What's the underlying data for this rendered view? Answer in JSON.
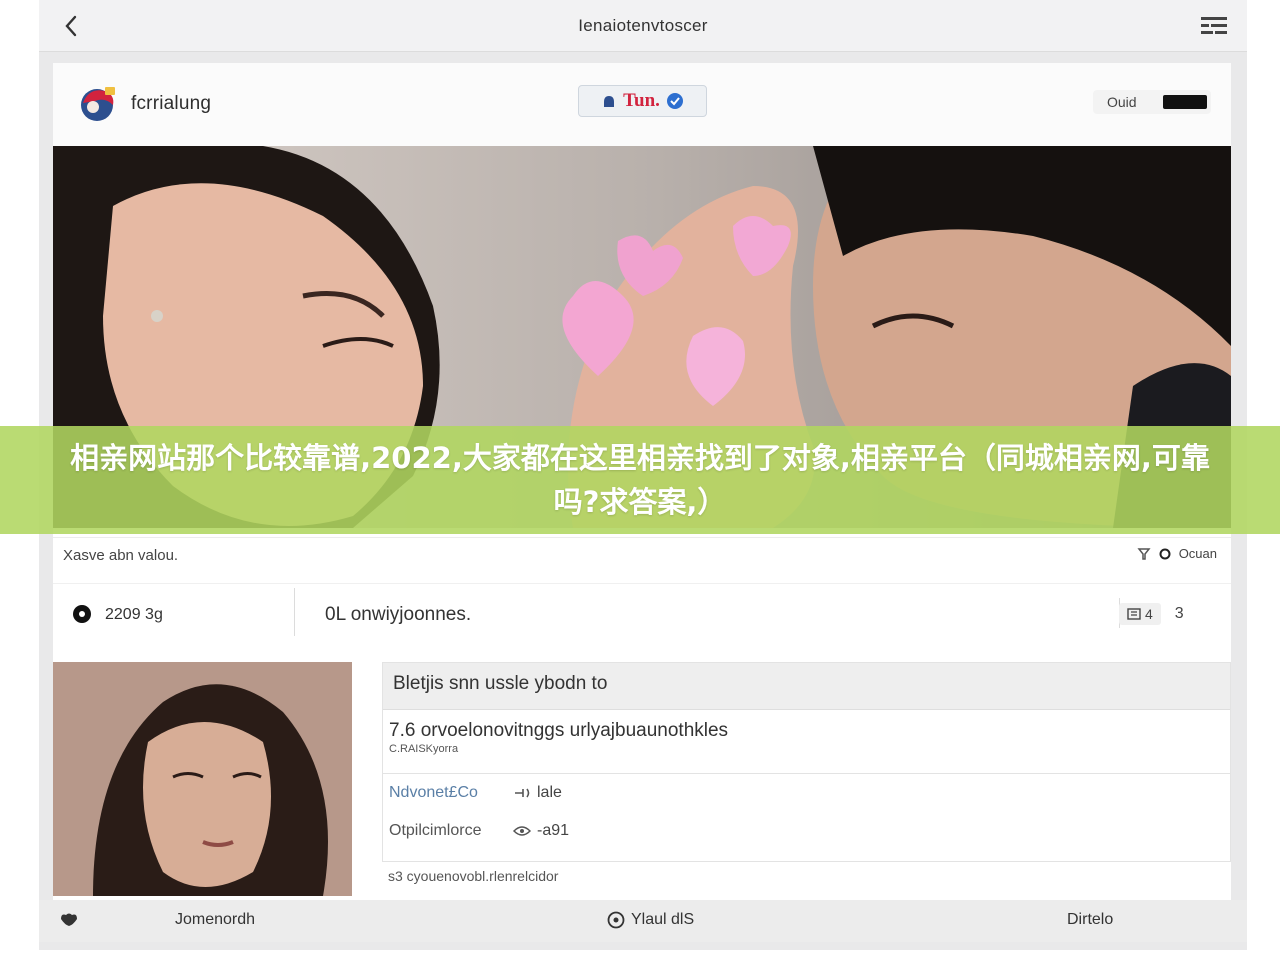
{
  "topbar": {
    "title": "Ienaiotenvtoscer"
  },
  "header": {
    "brand": "fcrrialung",
    "center_label": "Tun.",
    "account_label": "Ouid"
  },
  "banner": {
    "text": "相亲网站那个比较靠谱,2022,大家都在这里相亲找到了对象,相亲平台（同城相亲网,可靠吗?求答案,）"
  },
  "info_row": {
    "left_text": "Xasve abn valou.",
    "right_text": "Ocuan"
  },
  "location_row": {
    "distance": "2209 3g",
    "title": "0L onwiyjoonnes.",
    "count_a": "4",
    "count_b": "3"
  },
  "details": {
    "heading": "Bletjis snn ussle ybodn to",
    "subline_main": "7.6 orvoelonovitnggs urlyajbuaunothkles",
    "subline_small": "C.RAISKyorra",
    "rows": [
      {
        "key": "Ndvonet£Co",
        "value": "lale"
      },
      {
        "key": "Otpilcimlorce",
        "value": "-a91"
      }
    ],
    "footer": "s3 cyouenovobl.rlenrelcidor"
  },
  "bottom_nav": {
    "tab1": "Jomenordh",
    "tab2": "Ylaul dlS",
    "tab3": "Dirtelo"
  },
  "colors": {
    "banner_green": "#b0d660",
    "brand_red": "#d2233e",
    "page_gray": "#e9e9ea"
  },
  "icons": [
    "back-chevron-icon",
    "menu-grid-icon",
    "brand-logo-icon",
    "shield-icon",
    "location-pin-icon",
    "filter-icon",
    "circle-icon",
    "list-icon",
    "key-icon",
    "eye-icon",
    "messages-icon",
    "heart-chat-icon"
  ]
}
